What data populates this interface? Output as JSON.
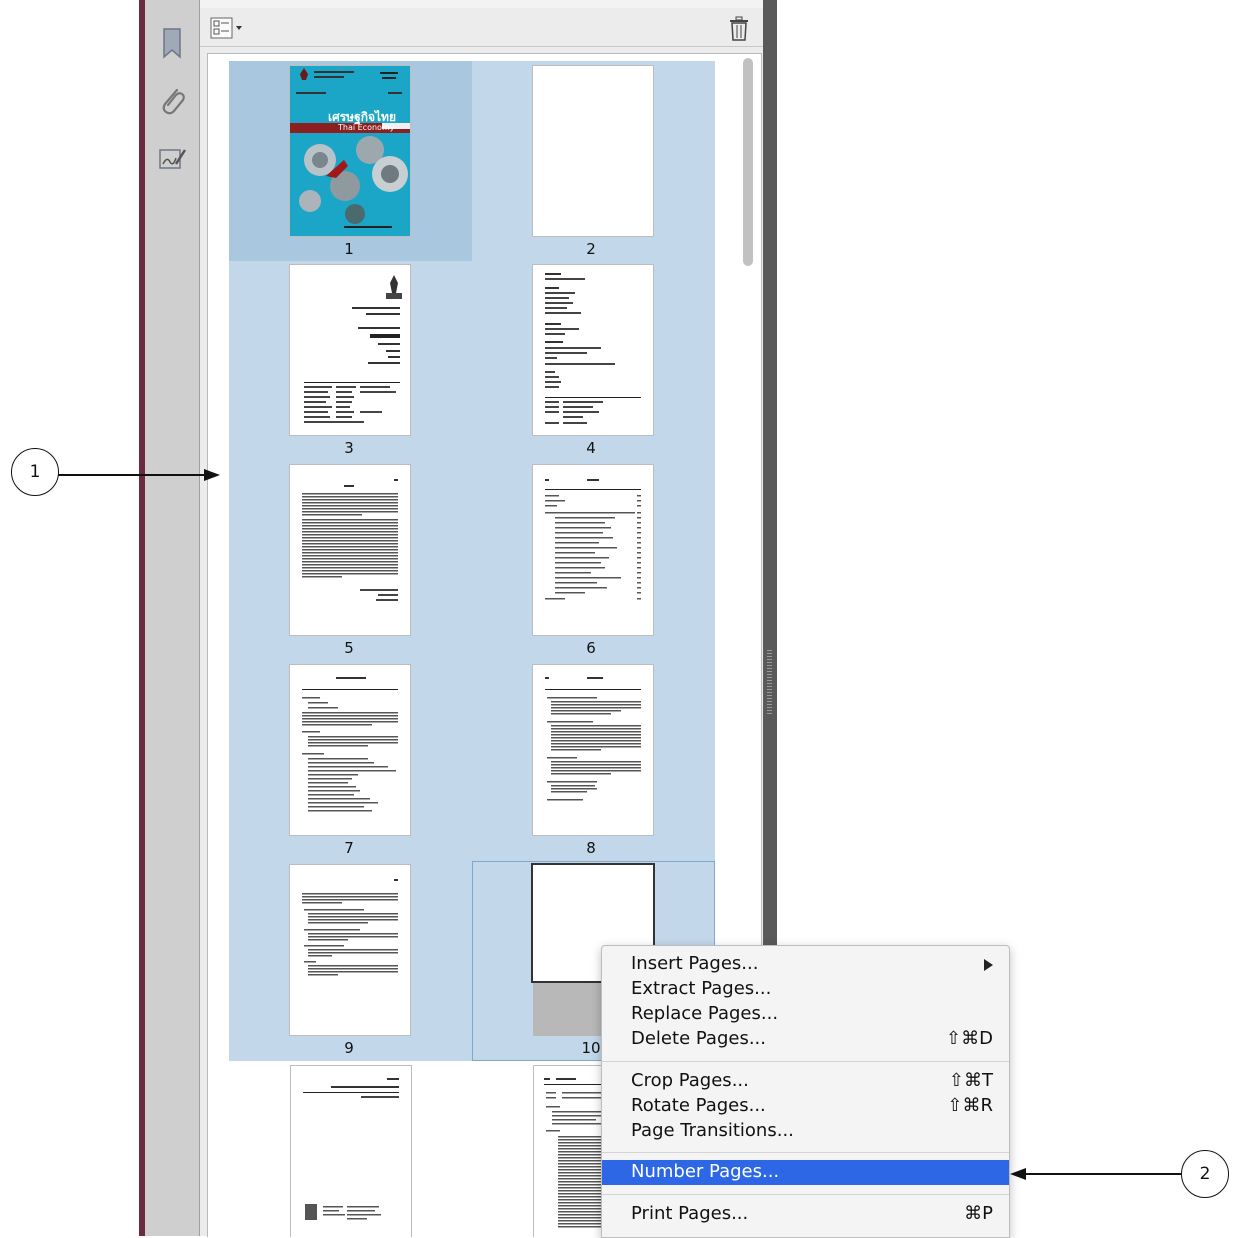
{
  "toolbar": {
    "options_icon": "page-options-icon",
    "delete_icon": "trash-icon"
  },
  "sidebar": {
    "items": [
      {
        "name": "bookmark-icon"
      },
      {
        "name": "paperclip-icon"
      },
      {
        "name": "signature-icon"
      }
    ]
  },
  "pages": [
    {
      "label": "1",
      "selected": true
    },
    {
      "label": "2",
      "selected": true
    },
    {
      "label": "3",
      "selected": true
    },
    {
      "label": "4",
      "selected": true
    },
    {
      "label": "5",
      "selected": true
    },
    {
      "label": "6",
      "selected": true
    },
    {
      "label": "7",
      "selected": true
    },
    {
      "label": "8",
      "selected": true
    },
    {
      "label": "9",
      "selected": true
    },
    {
      "label": "10",
      "selected": true
    }
  ],
  "cover": {
    "title": "เศรษฐกิจไทย",
    "subtitle": "Thai Economy"
  },
  "menu": {
    "items": [
      {
        "label": "Insert Pages...",
        "shortcut": "",
        "submenu": true
      },
      {
        "label": "Extract Pages...",
        "shortcut": ""
      },
      {
        "label": "Replace Pages...",
        "shortcut": ""
      },
      {
        "label": "Delete Pages...",
        "shortcut": "⇧⌘D"
      },
      {
        "label": "Crop Pages...",
        "shortcut": "⇧⌘T"
      },
      {
        "label": "Rotate Pages...",
        "shortcut": "⇧⌘R"
      },
      {
        "label": "Page Transitions...",
        "shortcut": ""
      },
      {
        "label": "Number Pages...",
        "shortcut": "",
        "highlighted": true
      },
      {
        "label": "Print Pages...",
        "shortcut": "⌘P"
      }
    ]
  },
  "callouts": [
    {
      "label": "1"
    },
    {
      "label": "2"
    }
  ],
  "colors": {
    "selection": "#c2d8ea",
    "menu_highlight": "#2d67e6"
  }
}
